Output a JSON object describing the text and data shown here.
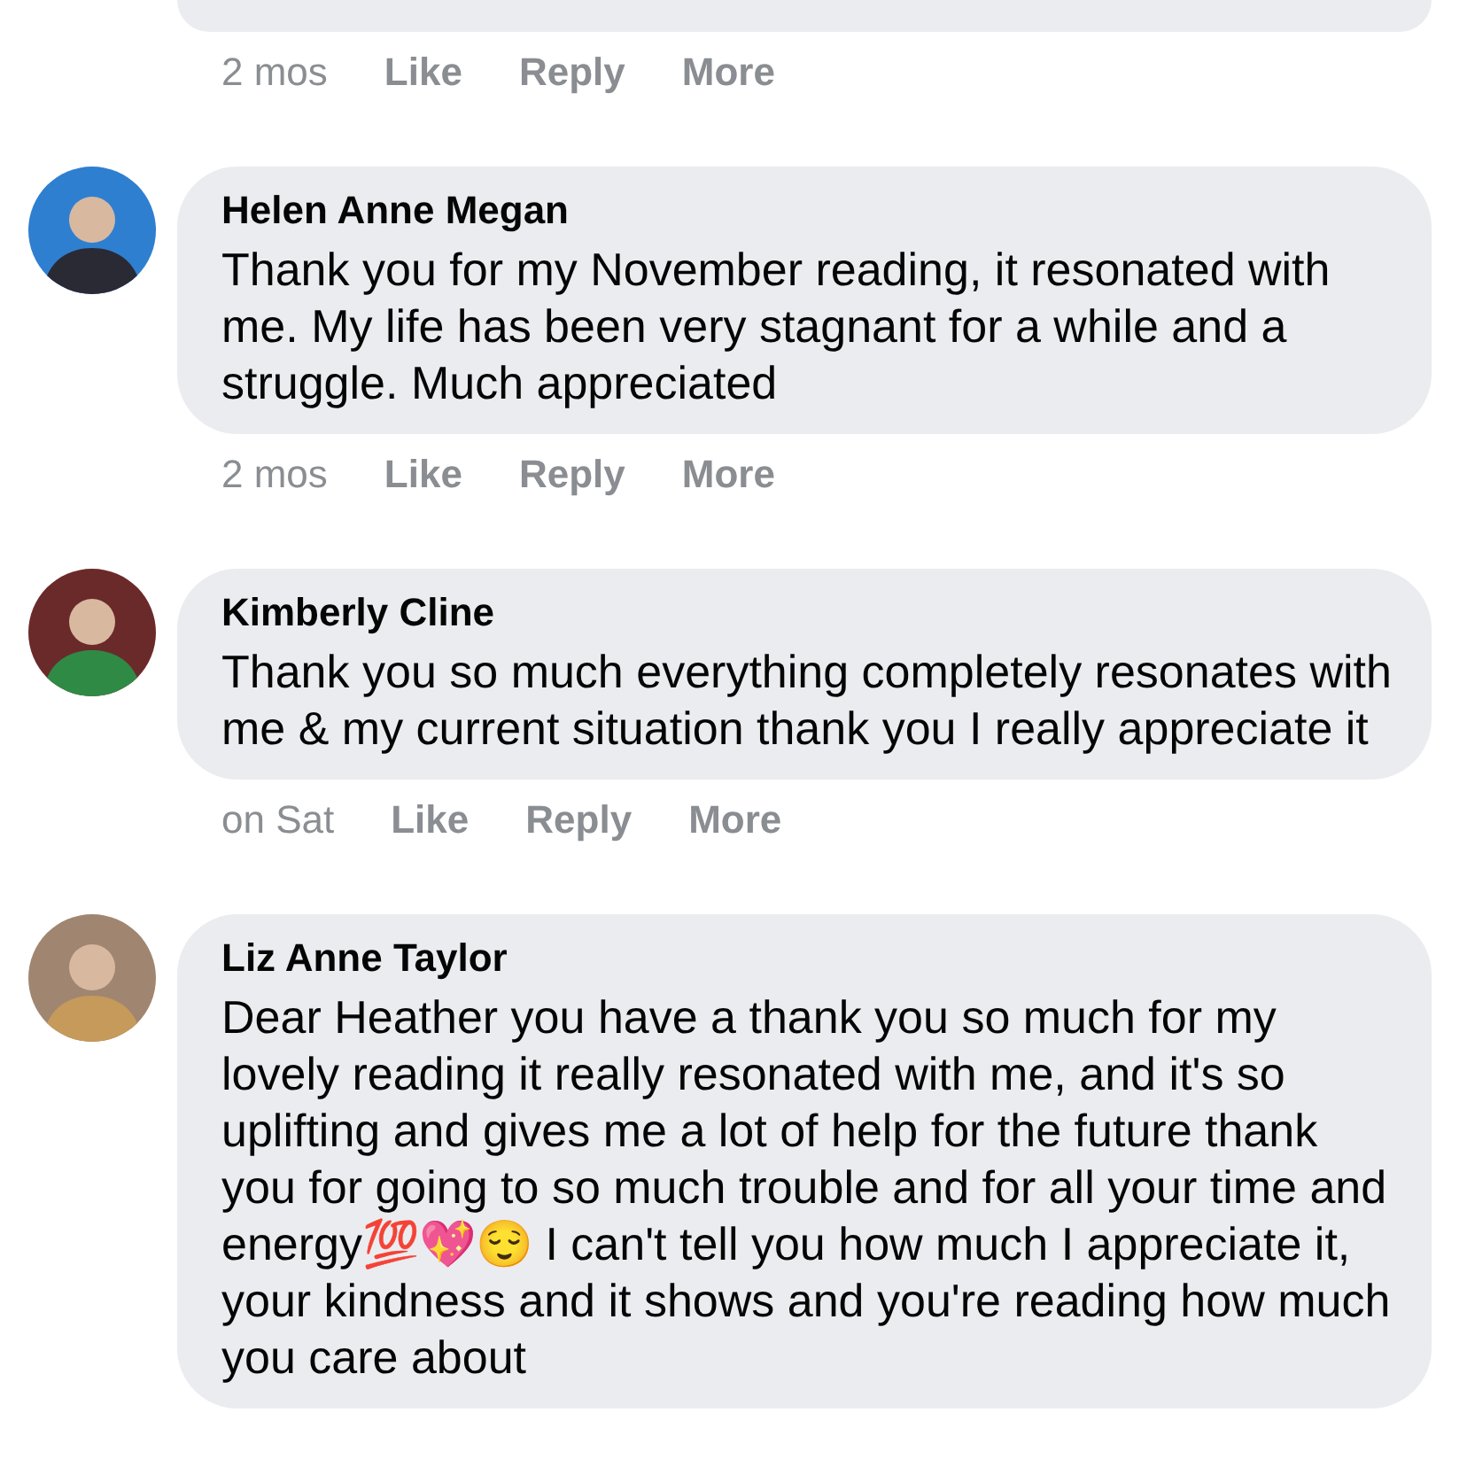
{
  "comments": [
    {
      "time": "2 mos",
      "actions": [
        "Like",
        "Reply",
        "More"
      ]
    },
    {
      "author": "Helen Anne Megan",
      "text": "Thank you for my November reading, it resonated with me. My life has been very stagnant for a while and a struggle. Much appreciated",
      "time": "2 mos",
      "actions": [
        "Like",
        "Reply",
        "More"
      ]
    },
    {
      "author": "Kimberly Cline",
      "text": "Thank you so much everything completely resonates with me & my current situation thank you I really appreciate it",
      "time": "on Sat",
      "actions": [
        "Like",
        "Reply",
        "More"
      ]
    },
    {
      "author": "Liz Anne Taylor",
      "text": "Dear Heather you have a thank you so much for my lovely reading it really resonated with me, and it's so uplifting and gives me a lot of help for the future thank you for going to so much trouble and for all your time and energy💯💖😌 I can't tell you how much I appreciate it, your kindness and it shows and you're reading how much you care about"
    }
  ]
}
